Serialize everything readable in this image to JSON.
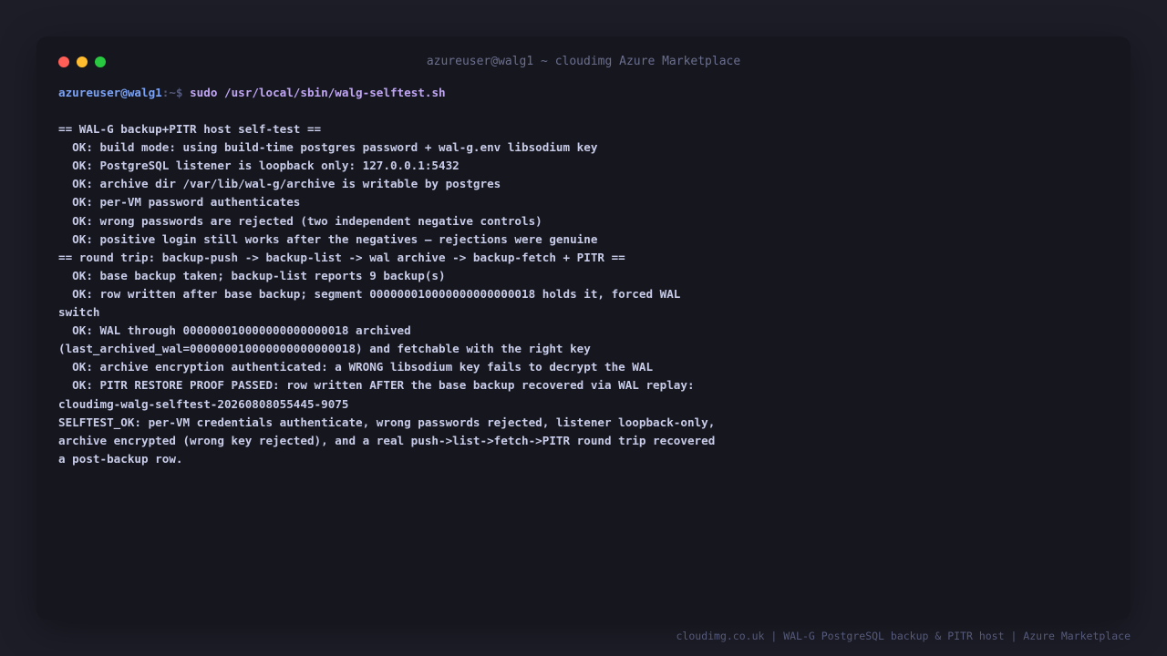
{
  "window": {
    "title": "azureuser@walg1 ~ cloudimg Azure Marketplace"
  },
  "prompt": {
    "user_host": "azureuser@walg1",
    "path": ":~$ ",
    "command": "sudo /usr/local/sbin/walg-selftest.sh"
  },
  "output": {
    "lines": [
      "== WAL-G backup+PITR host self-test ==",
      "  OK: build mode: using build-time postgres password + wal-g.env libsodium key",
      "  OK: PostgreSQL listener is loopback only: 127.0.0.1:5432",
      "  OK: archive dir /var/lib/wal-g/archive is writable by postgres",
      "  OK: per-VM password authenticates",
      "  OK: wrong passwords are rejected (two independent negative controls)",
      "  OK: positive login still works after the negatives — rejections were genuine",
      "== round trip: backup-push -> backup-list -> wal archive -> backup-fetch + PITR ==",
      "  OK: base backup taken; backup-list reports 9 backup(s)",
      "  OK: row written after base backup; segment 000000010000000000000018 holds it, forced WAL",
      "switch",
      "  OK: WAL through 000000010000000000000018 archived",
      "(last_archived_wal=000000010000000000000018) and fetchable with the right key",
      "  OK: archive encryption authenticated: a WRONG libsodium key fails to decrypt the WAL",
      "  OK: PITR RESTORE PROOF PASSED: row written AFTER the base backup recovered via WAL replay:",
      "cloudimg-walg-selftest-20260808055445-9075",
      "SELFTEST_OK: per-VM credentials authenticate, wrong passwords rejected, listener loopback-only,",
      "archive encrypted (wrong key rejected), and a real push->list->fetch->PITR round trip recovered",
      "a post-backup row."
    ]
  },
  "footer": {
    "text": "cloudimg.co.uk | WAL-G PostgreSQL backup & PITR host | Azure Marketplace"
  },
  "colors": {
    "background": "#1c1d27",
    "terminal_bg": "#15161e",
    "text": "#c8cce8",
    "prompt_user": "#7aa2f7",
    "prompt_command": "#c0a6f5",
    "close_dot": "#ff5f57",
    "minimize_dot": "#febc2e",
    "maximize_dot": "#28c840"
  }
}
